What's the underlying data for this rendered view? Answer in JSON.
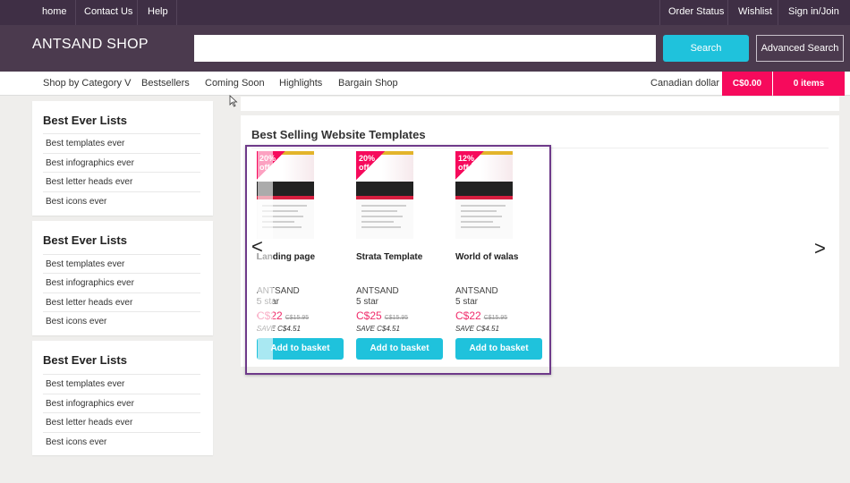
{
  "topnav": {
    "left": [
      "home",
      "Contact Us",
      "Help"
    ],
    "right": [
      "Order Status",
      "Wishlist",
      "Sign in/Join"
    ]
  },
  "header": {
    "logo": "ANTSAND SHOP",
    "search_value": "",
    "search_button": "Search",
    "advanced_button": "Advanced Search"
  },
  "category_bar": {
    "items": [
      "Shop by Category V",
      "Bestsellers",
      "Coming Soon",
      "Highlights",
      "Bargain Shop"
    ],
    "currency": "Canadian dollar",
    "cart_total": "C$0.00",
    "cart_items": "0 items"
  },
  "sidebar": [
    {
      "title": "Best Ever Lists",
      "items": [
        "Best templates ever",
        "Best infographics ever",
        "Best letter heads ever",
        "Best icons ever"
      ]
    },
    {
      "title": "Best Ever Lists",
      "items": [
        "Best templates ever",
        "Best infographics ever",
        "Best letter heads ever",
        "Best icons ever"
      ]
    },
    {
      "title": "Best Ever Lists",
      "items": [
        "Best templates ever",
        "Best infographics ever",
        "Best letter heads ever",
        "Best icons ever"
      ]
    }
  ],
  "main": {
    "section_title": "Best Selling Website Templates",
    "prev_icon": "chevron-left-icon",
    "next_icon": "chevron-right-icon",
    "prev_glyph": "<",
    "next_glyph": ">",
    "products": [
      {
        "discount_line1": "20%",
        "discount_line2": "off",
        "name": "Landing page",
        "brand": "ANTSAND",
        "rating": "5 star",
        "price": "C$22",
        "old_price": "C$15.95",
        "save": "SAVE C$4.51",
        "button": "Add to basket"
      },
      {
        "discount_line1": "20%",
        "discount_line2": "off",
        "name": "Strata Template",
        "brand": "ANTSAND",
        "rating": "5 star",
        "price": "C$25",
        "old_price": "C$15.95",
        "save": "SAVE C$4.51",
        "button": "Add to basket"
      },
      {
        "discount_line1": "12%",
        "discount_line2": "off",
        "name": "World of walas",
        "brand": "ANTSAND",
        "rating": "5 star",
        "price": "C$22",
        "old_price": "C$15.95",
        "save": "SAVE C$4.51",
        "button": "Add to basket"
      }
    ]
  },
  "colors": {
    "top": "#3f2f45",
    "header": "#4b3a4e",
    "accent": "#1fc2dc",
    "pink": "#f60a5c",
    "highlight_border": "#6e3a8a"
  }
}
